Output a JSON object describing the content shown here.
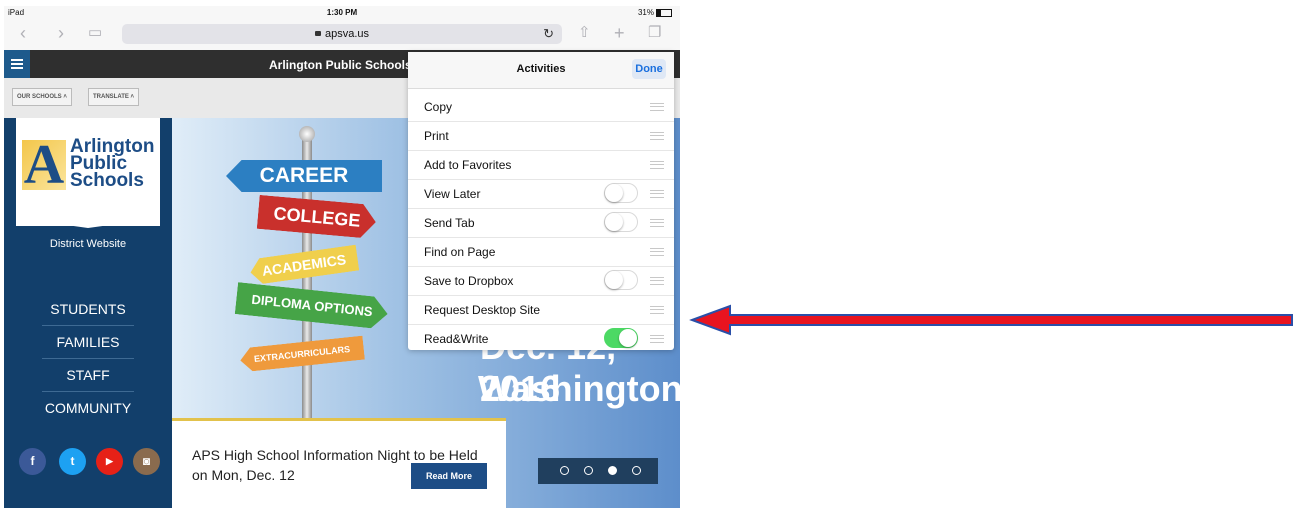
{
  "status": {
    "device": "iPad",
    "time": "1:30 PM",
    "battery": "31%"
  },
  "browser": {
    "url": "apsva.us"
  },
  "site": {
    "header_title": "Arlington Public Schools",
    "utility_links": [
      "OUR SCHOOLS",
      "TRANSLATE"
    ],
    "logo_lines": [
      "Arlington",
      "Public",
      "Schools"
    ],
    "logo_letter": "A",
    "district_label": "District Website",
    "menu": [
      "STUDENTS",
      "FAMILIES",
      "STAFF",
      "COMMUNITY"
    ],
    "social": [
      {
        "icon": "facebook-icon",
        "glyph": "f",
        "color": "#3b5998"
      },
      {
        "icon": "twitter-icon",
        "glyph": "t",
        "color": "#1da1f2"
      },
      {
        "icon": "youtube-icon",
        "glyph": "▶",
        "color": "#e62117"
      },
      {
        "icon": "instagram-icon",
        "glyph": "◙",
        "color": "#8a6b4e"
      }
    ],
    "signs": [
      "CAREER",
      "COLLEGE",
      "ACADEMICS",
      "DIPLOMA OPTIONS",
      "EXTRACURRICULARS"
    ],
    "hero_text": [
      "Dec. 12, 2016",
      "Washington"
    ],
    "news_text": "APS High School Information Night to be Held on Mon, Dec. 12",
    "read_more": "Read More"
  },
  "activities": {
    "title": "Activities",
    "done": "Done",
    "items": [
      {
        "label": "Copy",
        "toggle": null
      },
      {
        "label": "Print",
        "toggle": null
      },
      {
        "label": "Add to Favorites",
        "toggle": null
      },
      {
        "label": "View Later",
        "toggle": false
      },
      {
        "label": "Send Tab",
        "toggle": false
      },
      {
        "label": "Find on Page",
        "toggle": null
      },
      {
        "label": "Save to Dropbox",
        "toggle": false
      },
      {
        "label": "Request Desktop Site",
        "toggle": null
      },
      {
        "label": "Read&Write",
        "toggle": true
      }
    ]
  },
  "annotation": {
    "arrow_color": "#e8141f",
    "arrow_outline": "#2a4fa8"
  }
}
